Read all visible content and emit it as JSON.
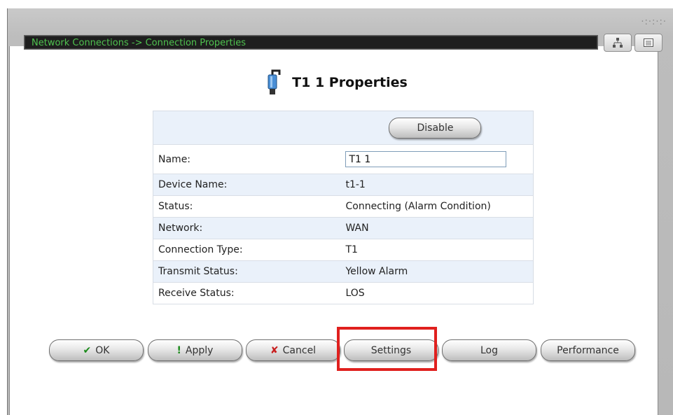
{
  "window": {
    "breadcrumb": "Network Connections -> Connection Properties",
    "corner_decoration": "·:·:·:·"
  },
  "toolbar": {
    "icons": [
      "network-tree-icon",
      "page-view-icon"
    ]
  },
  "page": {
    "title": "T1 1 Properties",
    "icon": "t1-connector-icon"
  },
  "properties": {
    "disable_label": "Disable",
    "name": {
      "label": "Name:",
      "value": "T1 1"
    },
    "rows": [
      {
        "label": "Device Name:",
        "value": "t1-1"
      },
      {
        "label": "Status:",
        "value": "Connecting (Alarm Condition)"
      },
      {
        "label": "Network:",
        "value": "WAN"
      },
      {
        "label": "Connection Type:",
        "value": "T1"
      },
      {
        "label": "Transmit Status:",
        "value": "Yellow Alarm"
      },
      {
        "label": "Receive Status:",
        "value": "LOS"
      }
    ]
  },
  "actions": {
    "ok": {
      "label": "OK",
      "icon": "checkmark-icon",
      "color": "#1a8a1a"
    },
    "apply": {
      "label": "Apply",
      "icon": "exclamation-icon",
      "color": "#1a8a1a"
    },
    "cancel": {
      "label": "Cancel",
      "icon": "x-icon",
      "color": "#c81e1e"
    },
    "settings": {
      "label": "Settings"
    },
    "log": {
      "label": "Log"
    },
    "performance": {
      "label": "Performance"
    }
  },
  "colors": {
    "breadcrumb_text": "#4fc24f",
    "highlight": "#e0201e",
    "row_alt": "#eaf1fa"
  }
}
